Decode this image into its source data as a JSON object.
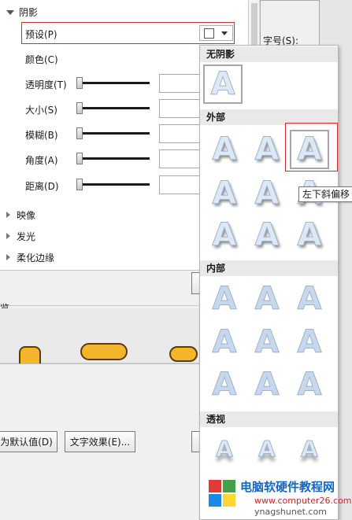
{
  "format_pane": {
    "section_title": "阴影",
    "preset_label": "预设(P)",
    "color_label": "颜色(C)",
    "rows": [
      {
        "label": "透明度(T)"
      },
      {
        "label": "大小(S)"
      },
      {
        "label": "模糊(B)"
      },
      {
        "label": "角度(A)"
      },
      {
        "label": "距离(D)"
      }
    ],
    "collapsed_sections": [
      "映像",
      "发光",
      "柔化边缘"
    ]
  },
  "right_panel": {
    "font_size_label": "字号(S):"
  },
  "preview": {
    "title": "览"
  },
  "buttons": {
    "set_default": "为默认值(D)",
    "text_effects": "文字效果(E)..."
  },
  "gallery": {
    "sections": [
      {
        "title": "无阴影"
      },
      {
        "title": "外部"
      },
      {
        "title": "内部"
      },
      {
        "title": "透视"
      }
    ],
    "glyph": "A",
    "tooltip": "左下斜偏移"
  },
  "watermark": {
    "title": "电脑软硬件教程网",
    "url": "www.computer26.com",
    "url2": "ynagshunet.com"
  }
}
